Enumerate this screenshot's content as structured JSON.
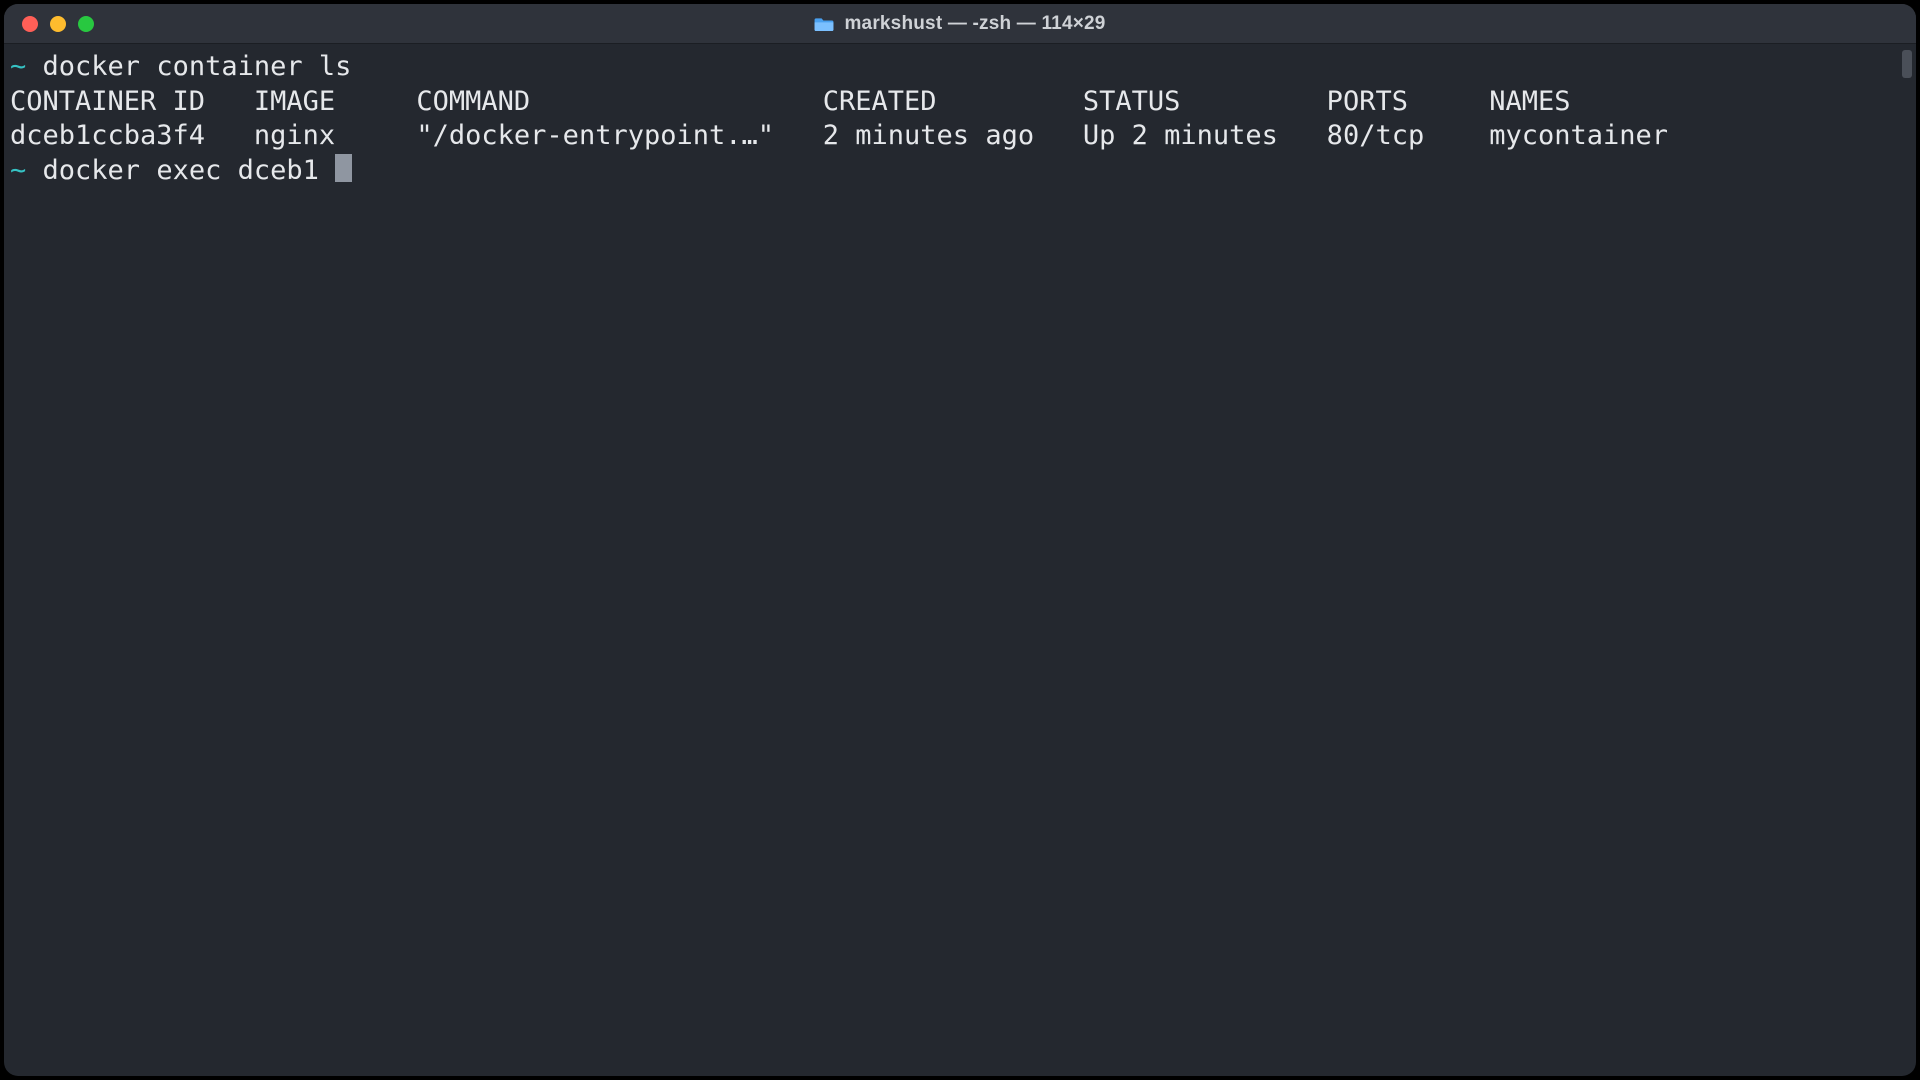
{
  "window": {
    "title": "markshust — -zsh — 114×29"
  },
  "prompt": {
    "symbol": "~"
  },
  "commands": {
    "line1": "docker container ls",
    "line2_partial": "docker exec dceb1 "
  },
  "table": {
    "headers": {
      "container_id": "CONTAINER ID",
      "image": "IMAGE",
      "command": "COMMAND",
      "created": "CREATED",
      "status": "STATUS",
      "ports": "PORTS",
      "names": "NAMES"
    },
    "row": {
      "container_id": "dceb1ccba3f4",
      "image": "nginx",
      "command": "\"/docker-entrypoint.…\"",
      "created": "2 minutes ago",
      "status": "Up 2 minutes",
      "ports": "80/tcp",
      "names": "mycontainer"
    }
  },
  "widths": {
    "container_id": 15,
    "image": 10,
    "command": 25,
    "created": 16,
    "status": 15,
    "ports": 10,
    "names": 12
  }
}
